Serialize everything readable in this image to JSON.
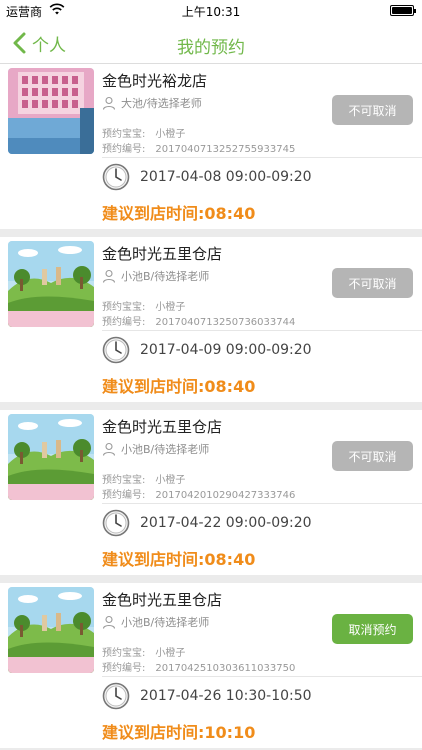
{
  "status_bar": {
    "carrier": "运营商",
    "time": "上午10:31"
  },
  "nav": {
    "back_label": "个人",
    "title": "我的预约"
  },
  "appointments": [
    {
      "store": "金色时光裕龙店",
      "teacher": "大池/待选择老师",
      "baby_label": "预约宝宝:",
      "baby": "小橙子",
      "code_label": "预约编号:",
      "code": "20170407132527559337​45",
      "datetime": "2017-04-08 09:00-09:20",
      "suggest": "建议到店时间:08:40",
      "button": "不可取消",
      "button_enabled": false,
      "image": "pink-room-photo"
    },
    {
      "store": "金色时光五里仓店",
      "teacher": "小池B/待选择老师",
      "baby_label": "预约宝宝:",
      "baby": "小橙子",
      "code_label": "预约编号:",
      "code": "20170407132507360337​44",
      "datetime": "2017-04-09 09:00-09:20",
      "suggest": "建议到店时间:08:40",
      "button": "不可取消",
      "button_enabled": false,
      "image": "mural-room-photo"
    },
    {
      "store": "金色时光五里仓店",
      "teacher": "小池B/待选择老师",
      "baby_label": "预约宝宝:",
      "baby": "小橙子",
      "code_label": "预约编号:",
      "code": "20170420102904273337​46",
      "datetime": "2017-04-22 09:00-09:20",
      "suggest": "建议到店时间:08:40",
      "button": "不可取消",
      "button_enabled": false,
      "image": "mural-room-photo"
    },
    {
      "store": "金色时光五里仓店",
      "teacher": "小池B/待选择老师",
      "baby_label": "预约宝宝:",
      "baby": "小橙子",
      "code_label": "预约编号:",
      "code": "20170425103036110337​50",
      "datetime": "2017-04-26 10:30-10:50",
      "suggest": "建议到店时间:10:10",
      "button": "取消预约",
      "button_enabled": true,
      "image": "mural-room-photo"
    }
  ],
  "colors": {
    "accent": "#71b84a",
    "suggest": "#f08c1a",
    "button_disabled": "#b5b5b5",
    "button_enabled": "#6ab242"
  }
}
